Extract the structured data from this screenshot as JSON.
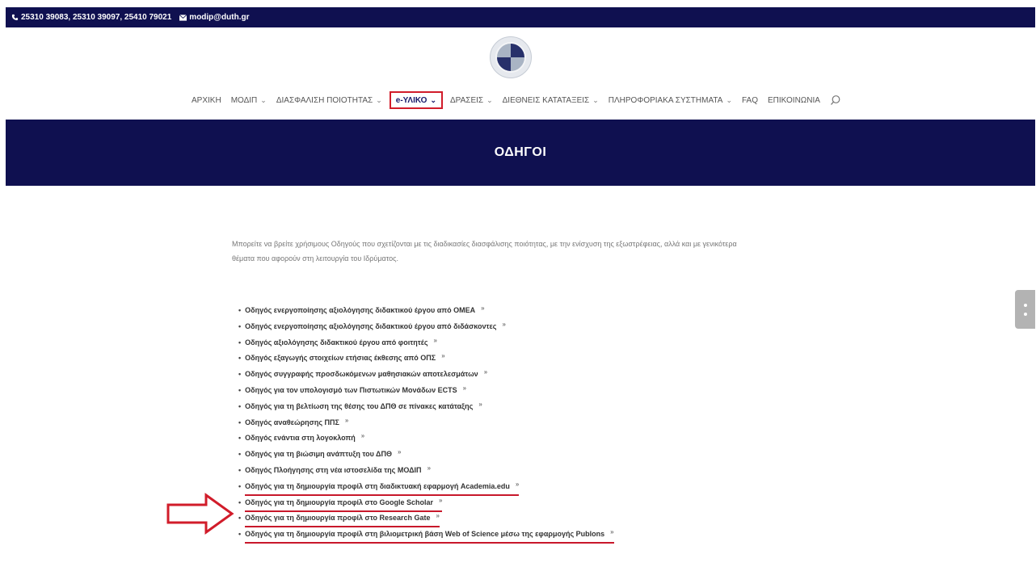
{
  "topbar": {
    "phone": "25310 39083, 25310 39097, 25410 79021",
    "email": "modip@duth.gr",
    "phone_icon": "phone-icon",
    "email_icon": "envelope-icon"
  },
  "nav": {
    "items": [
      {
        "label": "ΑΡΧΙΚΗ",
        "chevron": ""
      },
      {
        "label": "ΜΟΔΙΠ",
        "chevron": "⌄"
      },
      {
        "label": "ΔΙΑΣΦΑΛΙΣΗ ΠΟΙΟΤΗΤΑΣ",
        "chevron": "⌄"
      },
      {
        "label": "e-ΥΛΙΚΟ",
        "chevron": "⌄"
      },
      {
        "label": "ΔΡΑΣΕΙΣ",
        "chevron": "⌄"
      },
      {
        "label": "ΔΙΕΘΝΕΙΣ ΚΑΤΑΤΑΞΕΙΣ",
        "chevron": "⌄"
      },
      {
        "label": "ΠΛΗΡΟΦΟΡΙΑΚΑ ΣΥΣΤΗΜΑΤΑ",
        "chevron": "⌄"
      },
      {
        "label": "FAQ",
        "chevron": ""
      },
      {
        "label": "ΕΠΙΚΟΙΝΩΝΙΑ",
        "chevron": ""
      }
    ],
    "active_index": 3,
    "highlight_color": "#d11c2a"
  },
  "banner": {
    "title": "ΟΔΗΓΟΙ",
    "background": "#0f1050"
  },
  "intro": {
    "line1": "Μπορείτε να βρείτε χρήσιμους Οδηγούς που σχετίζονται με τις διαδικασίες διασφάλισης ποιότητας, με την ενίσχυση της εξωστρέφειας, αλλά και με γενικότερα",
    "line2": "θέματα που αφορούν στη λειτουργία του Ιδρύματος."
  },
  "guides": {
    "bullet": "•",
    "download_glyph": "»",
    "items": [
      "Οδηγός ενεργοποίησης αξιολόγησης διδακτικού έργου από ΟΜΕΑ",
      "Οδηγός ενεργοποίησης αξιολόγησης διδακτικού έργου από διδάσκοντες",
      "Οδηγός αξιολόγησης διδακτικού έργου από φοιτητές",
      "Οδηγός εξαγωγής στοιχείων ετήσιας έκθεσης από ΟΠΣ",
      "Οδηγός συγγραφής προσδωκόμενων μαθησιακών αποτελεσμάτων",
      "Οδηγός για τον υπολογισμό των Πιστωτικών Μονάδων ECTS",
      "Οδηγός για τη βελτίωση της θέσης του ΔΠΘ σε πίνακες κατάταξης",
      "Οδηγός αναθεώρησης ΠΠΣ",
      "Οδηγός ενάντια στη λογοκλοπή",
      "Οδηγός για τη βιώσιμη ανάπτυξη του ΔΠΘ",
      "Οδηγός Πλοήγησης στη νέα ιστοσελίδα της ΜΟΔΙΠ",
      "Οδηγός για τη δημιουργία προφίλ στη διαδικτυακή εφαρμογή Academia.edu",
      "Οδηγός για τη δημιουργία προφίλ στο Google Scholar",
      "Οδηγός για τη δημιουργία προφίλ στο Research Gate",
      "Οδηγός για τη δημιουργία προφίλ στη βιλιομετρική βάση Web of Science μέσω της εφαρμογής Publons"
    ],
    "highlighted_from": 11,
    "highlight_color": "#c8182b"
  },
  "annotation": {
    "arrow_icon": "right-arrow-outline-icon",
    "color": "#d11c2a"
  }
}
